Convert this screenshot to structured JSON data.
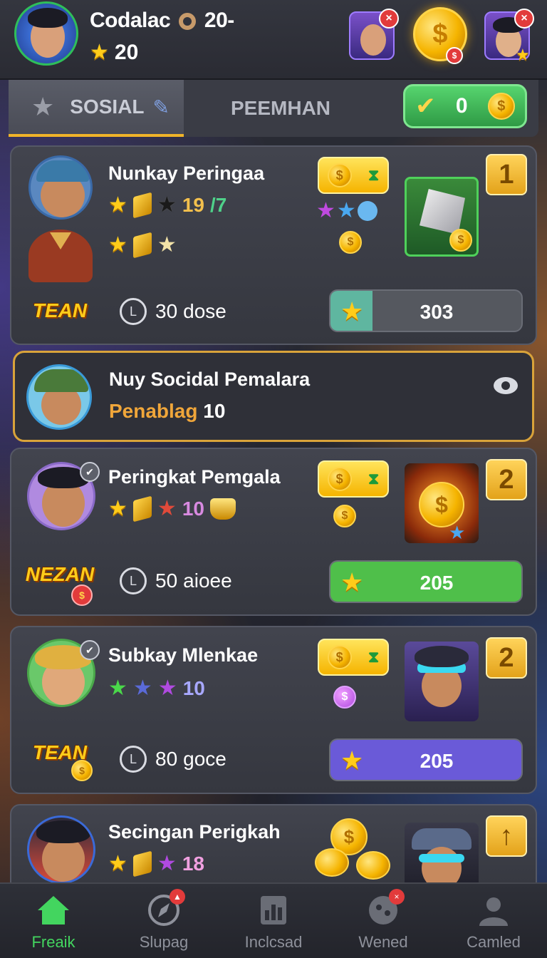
{
  "header": {
    "player_name": "Codalac",
    "player_level": "20-",
    "player_stars": "20",
    "badge_x": "×"
  },
  "tabs": {
    "social_label": "SOSIAL",
    "pemhan_label": "PEEMHAN",
    "pill_value": "0"
  },
  "entries": [
    {
      "name": "Nunkay Peringaa",
      "score": "19",
      "score_suffix": "/7",
      "rank": "1",
      "team_label": "TEAN",
      "time_value": "30",
      "time_unit": "dose",
      "progress_value": "303",
      "progress_fraction": 0.22,
      "progress_color": "#5fb6a0"
    },
    {
      "name": "Peringkat Pemgala",
      "score": "10",
      "rank": "2",
      "team_label": "NEZAN",
      "time_value": "50",
      "time_unit": "aioee",
      "progress_value": "205",
      "progress_fraction": 1.0,
      "progress_color": "#4fbf4a"
    },
    {
      "name": "Subkay Mlenkae",
      "score": "10",
      "rank": "2",
      "team_label": "TEAN",
      "time_value": "80",
      "time_unit": "goce",
      "progress_value": "205",
      "progress_fraction": 1.0,
      "progress_color": "#6a5ad8"
    },
    {
      "name": "Secingan Perigkah",
      "score": "18"
    }
  ],
  "social_banner": {
    "title": "Nuy Socidal Pemalara",
    "label": "Penablag",
    "value": "10"
  },
  "nav": {
    "items": [
      {
        "label": "Freaik",
        "icon": "home-icon"
      },
      {
        "label": "Slupag",
        "icon": "compass-icon"
      },
      {
        "label": "Inclcsad",
        "icon": "chart-icon"
      },
      {
        "label": "Wened",
        "icon": "ball-icon"
      },
      {
        "label": "Camled",
        "icon": "profile-icon"
      }
    ]
  },
  "colors": {
    "accent_green": "#43d55f",
    "gold": "#f5b400",
    "highlight_border": "#d9a33a"
  }
}
